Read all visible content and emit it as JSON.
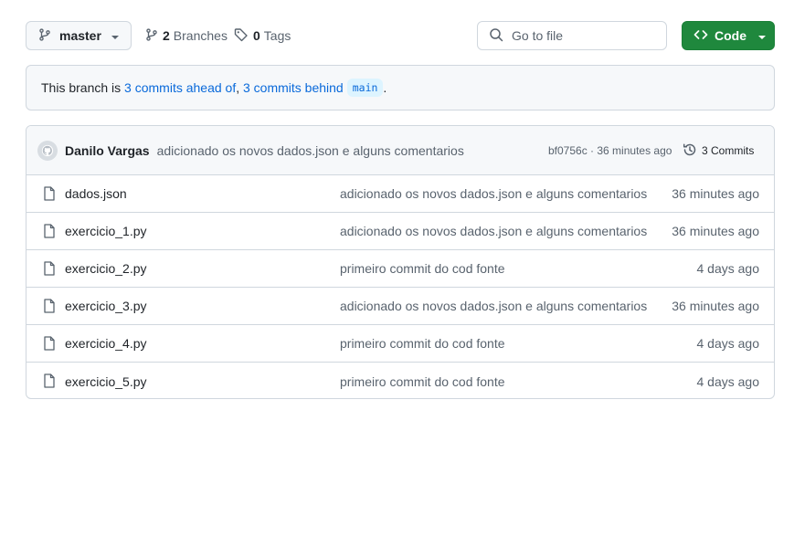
{
  "toolbar": {
    "branch_label": "master",
    "branches_count": "2",
    "branches_label": "Branches",
    "tags_count": "0",
    "tags_label": "Tags",
    "go_to_file_placeholder": "Go to file",
    "code_label": "Code"
  },
  "branch_info": {
    "prefix": "This branch is ",
    "ahead_link": "3 commits ahead of",
    "separator": ", ",
    "behind_link": "3 commits behind",
    "base_branch": "main",
    "suffix": "."
  },
  "latest_commit": {
    "author": "Danilo Vargas",
    "message": "adicionado os novos dados.json e alguns comentarios",
    "sha": "bf0756c",
    "dot": " · ",
    "age": "36 minutes ago",
    "commits_label": "3 Commits"
  },
  "files": [
    {
      "name": "dados.json",
      "message": "adicionado os novos dados.json e alguns comentarios",
      "age": "36 minutes ago"
    },
    {
      "name": "exercicio_1.py",
      "message": "adicionado os novos dados.json e alguns comentarios",
      "age": "36 minutes ago"
    },
    {
      "name": "exercicio_2.py",
      "message": "primeiro commit do cod fonte",
      "age": "4 days ago"
    },
    {
      "name": "exercicio_3.py",
      "message": "adicionado os novos dados.json e alguns comentarios",
      "age": "36 minutes ago"
    },
    {
      "name": "exercicio_4.py",
      "message": "primeiro commit do cod fonte",
      "age": "4 days ago"
    },
    {
      "name": "exercicio_5.py",
      "message": "primeiro commit do cod fonte",
      "age": "4 days ago"
    }
  ],
  "colors": {
    "accent_green": "#1f883d",
    "link_blue": "#0969da",
    "muted_text": "#59636e",
    "border": "#d0d7de",
    "subtle_bg": "#f6f8fa"
  },
  "icons": [
    "git-branch-icon",
    "caret-down-icon",
    "tag-icon",
    "search-icon",
    "code-icon",
    "avatar-icon",
    "history-icon",
    "file-icon"
  ]
}
